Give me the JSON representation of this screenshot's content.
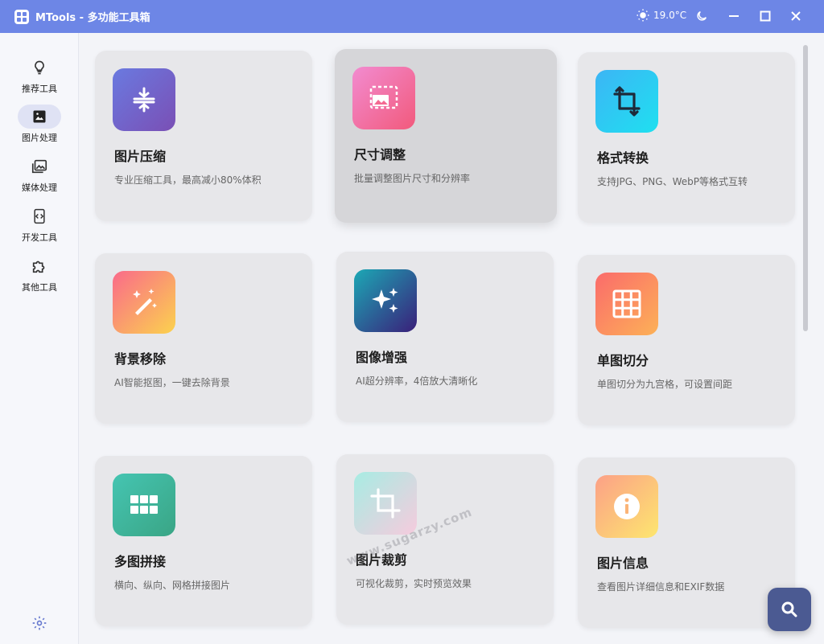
{
  "titlebar": {
    "title": "MTools - 多功能工具箱",
    "weather": "19.0°C"
  },
  "sidebar": {
    "items": [
      {
        "label": "推荐工具",
        "icon": "lightbulb-icon"
      },
      {
        "label": "图片处理",
        "icon": "image-icon",
        "active": true
      },
      {
        "label": "媒体处理",
        "icon": "media-library-icon"
      },
      {
        "label": "开发工具",
        "icon": "dev-code-icon"
      },
      {
        "label": "其他工具",
        "icon": "puzzle-icon"
      }
    ],
    "settings_icon": "gear-icon"
  },
  "cards": [
    {
      "title": "图片压缩",
      "desc": "专业压缩工具，最高减小80%体积",
      "icon": "compress-icon",
      "colors": [
        "#6a7ae0",
        "#7a4fb5"
      ]
    },
    {
      "title": "尺寸调整",
      "desc": "批量调整图片尺寸和分辨率",
      "icon": "resize-icon",
      "colors": [
        "#f28bd0",
        "#f25a7c"
      ]
    },
    {
      "title": "格式转换",
      "desc": "支持JPG、PNG、WebP等格式互转",
      "icon": "crop-rotate-icon",
      "colors": [
        "#3cb5f5",
        "#1fe0f0"
      ]
    },
    {
      "title": "背景移除",
      "desc": "AI智能抠图，一键去除背景",
      "icon": "magic-wand-icon",
      "colors": [
        "#fa6a8a",
        "#fbd24e"
      ]
    },
    {
      "title": "图像增强",
      "desc": "AI超分辨率，4倍放大清晰化",
      "icon": "sparkles-icon",
      "colors": [
        "#1ca8b5",
        "#3a1f7a"
      ]
    },
    {
      "title": "单图切分",
      "desc": "单图切分为九宫格，可设置间距",
      "icon": "grid-icon",
      "colors": [
        "#fb6b6b",
        "#fcb157"
      ]
    },
    {
      "title": "多图拼接",
      "desc": "横向、纵向、网格拼接图片",
      "icon": "collage-icon",
      "colors": [
        "#45c5b2",
        "#3aa585"
      ]
    },
    {
      "title": "图片裁剪",
      "desc": "可视化裁剪，实时预览效果",
      "icon": "crop-icon",
      "colors": [
        "#a7ece3",
        "#f6cbdd"
      ]
    },
    {
      "title": "图片信息",
      "desc": "查看图片详细信息和EXIF数据",
      "icon": "info-icon",
      "colors": [
        "#fca087",
        "#fde66f"
      ]
    }
  ],
  "watermark": "www.sugarzy.com",
  "fab_icon": "search-icon"
}
